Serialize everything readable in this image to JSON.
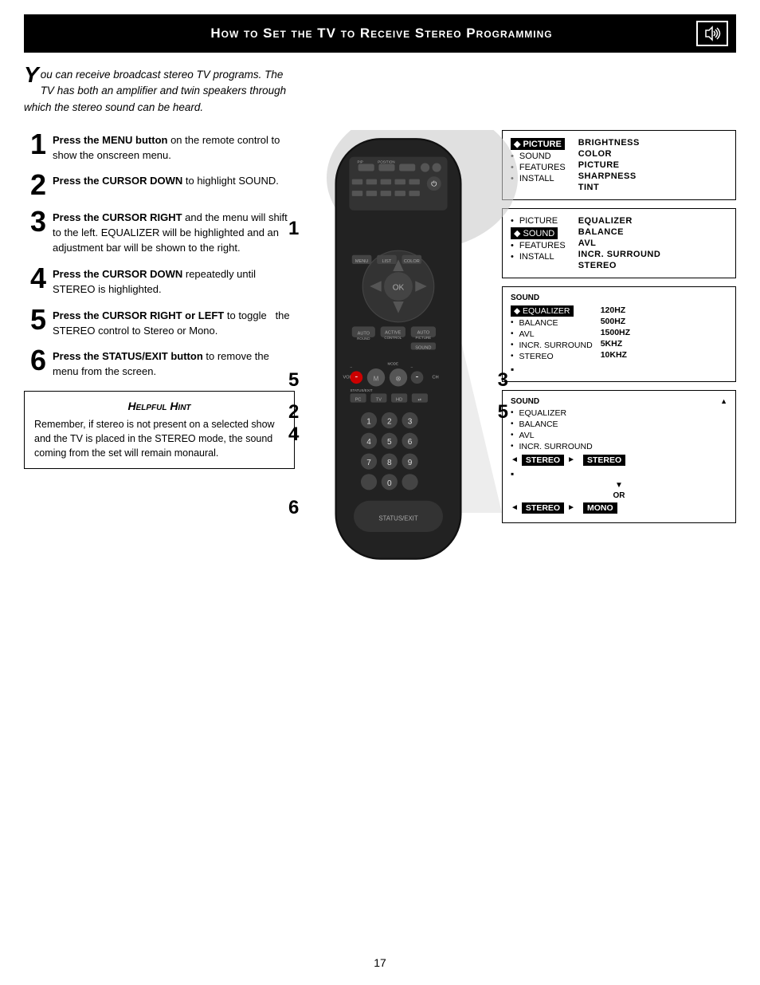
{
  "header": {
    "title": "How to Set the TV to Receive Stereo Programming",
    "icon": "🔊"
  },
  "intro": {
    "big_letter": "Y",
    "text": "ou can receive broadcast stereo TV programs.  The TV has both an amplifier and twin speakers through which the stereo sound can be heard."
  },
  "steps": [
    {
      "num": "1",
      "text": "Press the MENU button on the remote control to show the onscreen menu."
    },
    {
      "num": "2",
      "text": "Press the CURSOR DOWN to highlight SOUND."
    },
    {
      "num": "3",
      "text": "Press the CURSOR RIGHT and the menu will shift to the left. EQUALIZER will be highlighted and an adjustment bar will be shown to the right."
    },
    {
      "num": "4",
      "text": "Press the CURSOR DOWN repeatedly until STEREO is highlighted."
    },
    {
      "num": "5",
      "text": "Press the CURSOR RIGHT or LEFT to toggle  the STEREO control to Stereo or Mono."
    },
    {
      "num": "6",
      "text": "Press the STATUS/EXIT button to remove the menu from the screen."
    }
  ],
  "hint": {
    "title": "Helpful Hint",
    "text": "Remember, if stereo is not present on a selected show and the TV is placed in the STEREO mode, the sound coming from the set will remain monaural."
  },
  "menu_panel_1": {
    "left": [
      {
        "bullet": "◆",
        "label": "PICTURE",
        "highlighted": true
      },
      {
        "bullet": "•",
        "label": "SOUND"
      },
      {
        "bullet": "•",
        "label": "FEATURES"
      },
      {
        "bullet": "•",
        "label": "INSTALL"
      }
    ],
    "right": [
      {
        "label": "BRIGHTNESS"
      },
      {
        "label": "COLOR"
      },
      {
        "label": "PICTURE"
      },
      {
        "label": "SHARPNESS"
      },
      {
        "label": "TINT"
      }
    ]
  },
  "menu_panel_2": {
    "left": [
      {
        "bullet": "•",
        "label": "PICTURE"
      },
      {
        "bullet": "◆",
        "label": "SOUND",
        "highlighted": true
      },
      {
        "bullet": "•",
        "label": "FEATURES"
      },
      {
        "bullet": "•",
        "label": "INSTALL"
      }
    ],
    "right": [
      {
        "label": "EQUALIZER"
      },
      {
        "label": "BALANCE"
      },
      {
        "label": "AVL"
      },
      {
        "label": "INCR. SURROUND"
      },
      {
        "label": "STEREO"
      }
    ]
  },
  "menu_panel_3": {
    "section": "SOUND",
    "items": [
      {
        "bullet": "◆",
        "label": "EQUALIZER",
        "highlighted": true,
        "value": "120HZ"
      },
      {
        "bullet": "•",
        "label": "BALANCE",
        "value": "500HZ"
      },
      {
        "bullet": "•",
        "label": "AVL",
        "value": "1500HZ"
      },
      {
        "bullet": "•",
        "label": "INCR. SURROUND",
        "value": "5KHZ"
      },
      {
        "bullet": "•",
        "label": "STEREO",
        "value": "10KHZ"
      },
      {
        "bullet": "▪",
        "label": ""
      }
    ]
  },
  "menu_panel_4": {
    "section": "SOUND",
    "items": [
      {
        "bullet": "•",
        "label": "EQUALIZER"
      },
      {
        "bullet": "•",
        "label": "BALANCE"
      },
      {
        "bullet": "•",
        "label": "AVL"
      },
      {
        "bullet": "•",
        "label": "INCR. SURROUND"
      }
    ],
    "stereo_row": {
      "left_arrow": "◄",
      "label": "STEREO",
      "right_arrow": "►",
      "right_label": "STEREO",
      "highlighted": true
    },
    "or_label": "OR",
    "mono_row": {
      "left_arrow": "◄",
      "label": "STEREO",
      "right_arrow": "►",
      "right_label": "MONO",
      "highlighted": true
    }
  },
  "page_number": "17"
}
